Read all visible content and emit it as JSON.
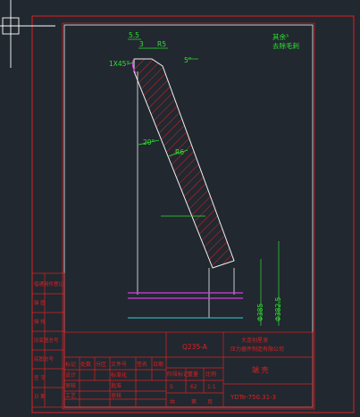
{
  "colors": {
    "background": "#212830",
    "frame": "#e02020",
    "geometry": "#f0f0f0",
    "dimension": "#30e030",
    "hatch": "#e02020",
    "magenta": "#d040e0",
    "cyan": "#30d0d0",
    "cursor": "#ffffff"
  },
  "dimensions": {
    "d55": "5.5",
    "d3": "3",
    "r5": "R5",
    "chamfer": "1X45°",
    "angle5": "5°",
    "angle20": "20°",
    "r6": "R6",
    "dia1": "Φ385",
    "dia2": "Φ382.5",
    "note_a": "其余³",
    "note_b": "去除毛刺"
  },
  "title_block": {
    "left_labels": [
      "借通用件登记",
      "描 图",
      "描 校",
      "旧底图总号",
      "底图总号",
      "签 字",
      "日 期"
    ],
    "material": "Q235-A",
    "company_line1": "大连创星液",
    "company_line2": "压力器件制造有限公司",
    "col_mark": "标记",
    "col_count": "处数",
    "col_zone": "分区",
    "col_docno": "文件号",
    "col_sign": "签名",
    "col_date": "日期",
    "row_design": "设计",
    "row_check": "审核",
    "row_craft": "工艺",
    "row_std": "标准化",
    "row_approve": "批准",
    "row_audit": "审核",
    "stage_mark": "阶段标记",
    "weight": "重量",
    "scale": "比例",
    "stage_val": "S",
    "weight_val": "62",
    "scale_val": "1:1",
    "sheet": "共",
    "page": "第",
    "page_word": "页",
    "part_name": "端 壳",
    "drawing_no": "YDTe-750.31-3"
  }
}
